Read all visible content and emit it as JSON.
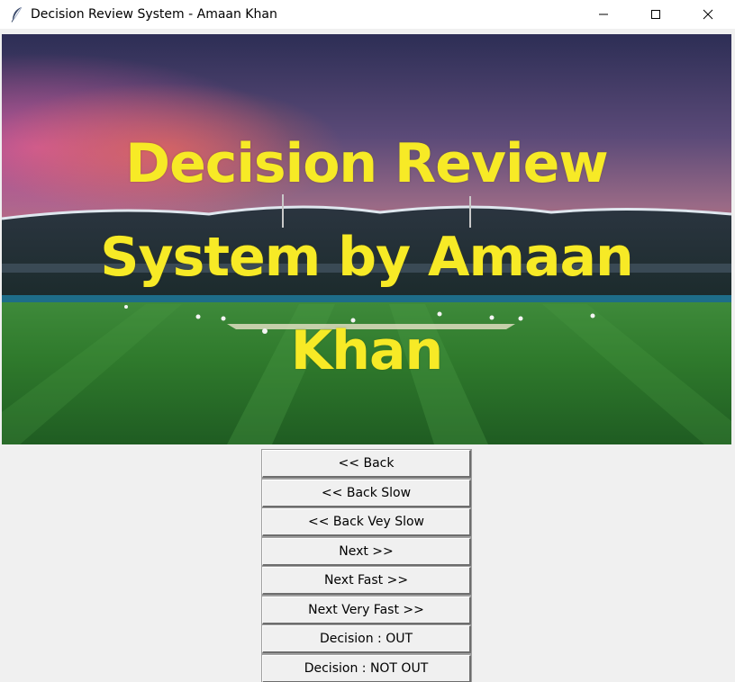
{
  "window": {
    "title": "Decision Review System - Amaan Khan",
    "icon": "feather-icon",
    "controls": [
      "minimize-icon",
      "maximize-icon",
      "close-icon"
    ]
  },
  "hero": {
    "title_lines": [
      "Decision Review",
      "System by Amaan",
      "Khan"
    ],
    "title_color": "#f7ea26"
  },
  "buttons": [
    {
      "label": "<< Back"
    },
    {
      "label": "<< Back Slow"
    },
    {
      "label": "<< Back Vey Slow"
    },
    {
      "label": "Next >>"
    },
    {
      "label": "Next Fast >>"
    },
    {
      "label": "Next Very Fast >>"
    },
    {
      "label": "Decision : OUT"
    },
    {
      "label": "Decision : NOT OUT"
    }
  ]
}
